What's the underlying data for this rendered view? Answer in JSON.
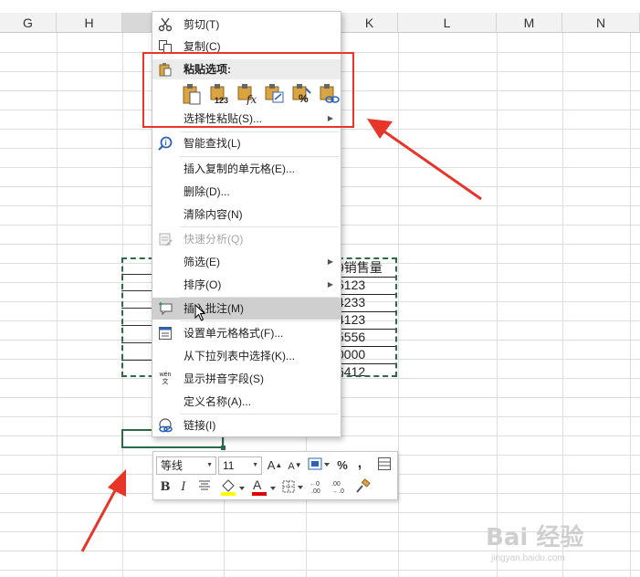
{
  "columns": [
    {
      "letter": "G",
      "selected": false
    },
    {
      "letter": "H",
      "selected": false
    },
    {
      "letter": "",
      "selected": true
    },
    {
      "letter": "K",
      "selected": false
    },
    {
      "letter": "L",
      "selected": false
    },
    {
      "letter": "M",
      "selected": false
    },
    {
      "letter": "N",
      "selected": false
    }
  ],
  "visible_cells": [
    "9销售量",
    "5123",
    "4233",
    "4123",
    "5556",
    "0000",
    "6412"
  ],
  "context_menu": {
    "cut": "剪切(T)",
    "copy": "复制(C)",
    "paste_options_header": "粘贴选项:",
    "paste_icon_labels": [
      "123"
    ],
    "paste_special": "选择性粘贴(S)...",
    "smart_lookup": "智能查找(L)",
    "insert_copied": "插入复制的单元格(E)...",
    "delete": "删除(D)...",
    "clear_contents": "清除内容(N)",
    "quick_analysis": "快速分析(Q)",
    "filter": "筛选(E)",
    "sort": "排序(O)",
    "insert_comment": "插入批注(M)",
    "format_cells": "设置单元格格式(F)...",
    "pick_from_list": "从下拉列表中选择(K)...",
    "phonetic": "显示拼音字段(S)",
    "define_name": "定义名称(A)...",
    "link": "链接(I)",
    "phonetic_icon_text": "wén文"
  },
  "mini_toolbar": {
    "font_name": "等线",
    "font_size": "11",
    "percent": "%",
    "comma": ",",
    "bold": "B",
    "italic": "I",
    "font_color_letter": "A"
  },
  "colors": {
    "highlight_red": "#e8352a",
    "arrow_red": "#e8352a",
    "selection_green": "#2d6b47",
    "fill_yellow": "#ffff00",
    "font_red": "#e00000"
  },
  "watermark": {
    "main": "Bai 经验",
    "sub": "jingyan.baidu.com"
  }
}
